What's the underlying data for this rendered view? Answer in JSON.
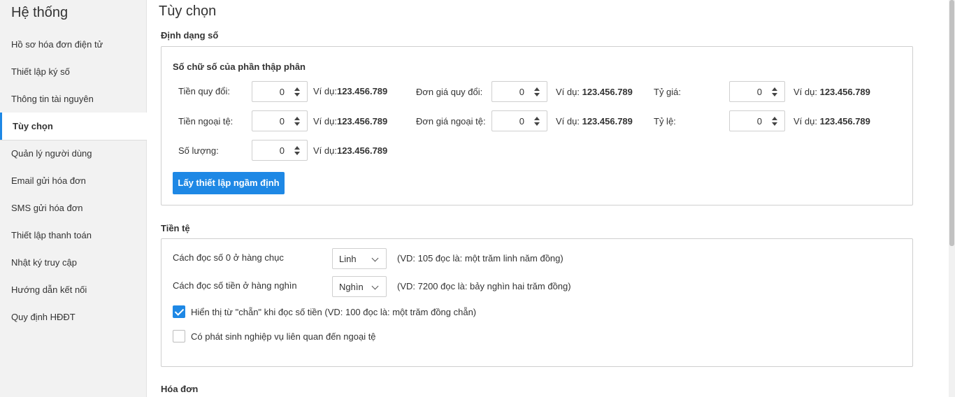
{
  "sidebar": {
    "title": "Hệ thống",
    "items": [
      {
        "label": "Hồ sơ hóa đơn điện tử"
      },
      {
        "label": "Thiết lập ký số"
      },
      {
        "label": "Thông tin tài nguyên"
      },
      {
        "label": "Tùy chọn",
        "active": true
      },
      {
        "label": "Quản lý người dùng"
      },
      {
        "label": "Email gửi hóa đơn"
      },
      {
        "label": "SMS gửi hóa đơn"
      },
      {
        "label": "Thiết lập thanh toán"
      },
      {
        "label": "Nhật ký truy cập"
      },
      {
        "label": "Hướng dẫn kết nối"
      },
      {
        "label": "Quy định HĐĐT"
      }
    ]
  },
  "main": {
    "title": "Tùy chọn",
    "number_format": {
      "section_label": "Định dạng số",
      "decimal_title": "Số chữ số của phần thập phân",
      "example_prefix": "Ví dụ:",
      "example_value": "123.456.789",
      "fields": [
        {
          "label": "Tiền quy đổi:",
          "value": "0"
        },
        {
          "label": "Đơn giá quy đổi:",
          "value": "0"
        },
        {
          "label": "Tỷ giá:",
          "value": "0"
        },
        {
          "label": "Tiền ngoại tệ:",
          "value": "0"
        },
        {
          "label": "Đơn giá ngoại tệ:",
          "value": "0"
        },
        {
          "label": "Tỷ lệ:",
          "value": "0"
        },
        {
          "label": "Số lượng:",
          "value": "0"
        }
      ],
      "default_button": "Lấy thiết lập ngầm định"
    },
    "currency": {
      "section_label": "Tiền tệ",
      "zero_tens": {
        "label": "Cách đọc số 0 ở hàng chục",
        "value": "Linh",
        "hint": "(VD: 105 đọc là: một trăm linh năm đồng)"
      },
      "thousands": {
        "label": "Cách đọc số tiền ở hàng nghìn",
        "value": "Nghìn",
        "hint": "(VD: 7200 đọc là: bảy nghìn hai trăm đồng)"
      },
      "show_chan": {
        "label": "Hiển thị từ \"chẵn\" khi đọc số tiền (VD: 100 đọc là: một trăm đồng chẵn)",
        "checked": true
      },
      "foreign_ops": {
        "label": "Có phát sinh nghiệp vụ liên quan đến ngoại tệ",
        "checked": false
      }
    },
    "invoice": {
      "section_label": "Hóa đơn"
    }
  }
}
